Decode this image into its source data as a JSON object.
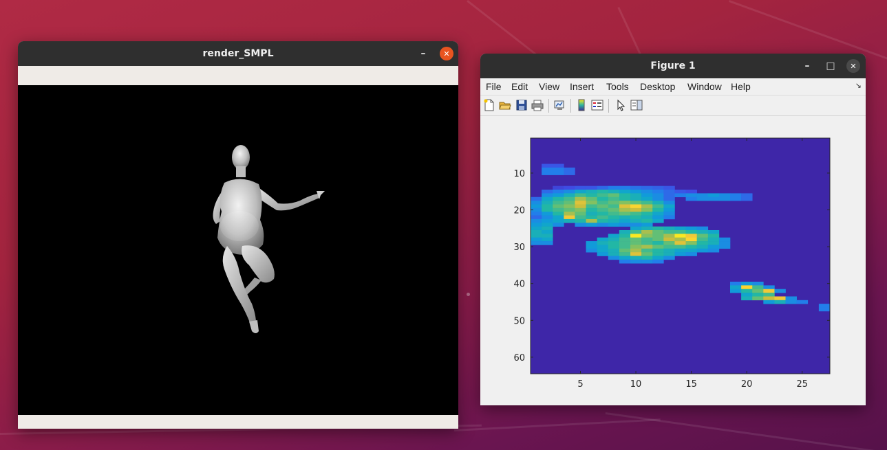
{
  "render_window": {
    "title": "render_SMPL",
    "minimize_symbol": "–",
    "close_symbol": "✕"
  },
  "figure_window": {
    "title": "Figure 1",
    "minimize_symbol": "–",
    "maximize_symbol": "□",
    "close_symbol": "✕",
    "menu": [
      "File",
      "Edit",
      "View",
      "Insert",
      "Tools",
      "Desktop",
      "Window",
      "Help"
    ],
    "dock_symbol": "↘",
    "toolbar_icons": [
      "new-figure-icon",
      "open-file-icon",
      "save-icon",
      "print-icon",
      "link-plot-icon",
      "colorbar-icon",
      "legend-icon",
      "pointer-icon",
      "property-editor-icon"
    ]
  },
  "chart_data": {
    "type": "heatmap",
    "title": "",
    "xlabel": "",
    "ylabel": "",
    "x_ticks": [
      5,
      10,
      15,
      20,
      25
    ],
    "y_ticks": [
      10,
      20,
      30,
      40,
      50,
      60
    ],
    "xlim": [
      0.5,
      27.5
    ],
    "ylim": [
      0.5,
      64.5
    ],
    "y_reversed": true,
    "colormap": "parula",
    "background_value": 0,
    "value_range": [
      0,
      1
    ],
    "cells": [
      [
        2,
        8,
        0.15
      ],
      [
        3,
        8,
        0.15
      ],
      [
        2,
        9,
        0.25
      ],
      [
        3,
        9,
        0.25
      ],
      [
        4,
        9,
        0.2
      ],
      [
        2,
        10,
        0.25
      ],
      [
        3,
        10,
        0.25
      ],
      [
        4,
        10,
        0.2
      ],
      [
        3,
        14,
        0.1
      ],
      [
        4,
        14,
        0.12
      ],
      [
        5,
        14,
        0.15
      ],
      [
        6,
        14,
        0.15
      ],
      [
        7,
        14,
        0.2
      ],
      [
        8,
        14,
        0.25
      ],
      [
        9,
        14,
        0.25
      ],
      [
        10,
        14,
        0.22
      ],
      [
        11,
        14,
        0.2
      ],
      [
        12,
        14,
        0.18
      ],
      [
        13,
        14,
        0.15
      ],
      [
        2,
        15,
        0.2
      ],
      [
        3,
        15,
        0.25
      ],
      [
        4,
        15,
        0.3
      ],
      [
        5,
        15,
        0.4
      ],
      [
        6,
        15,
        0.45
      ],
      [
        7,
        15,
        0.5
      ],
      [
        8,
        15,
        0.45
      ],
      [
        9,
        15,
        0.4
      ],
      [
        10,
        15,
        0.35
      ],
      [
        11,
        15,
        0.3
      ],
      [
        12,
        15,
        0.25
      ],
      [
        13,
        15,
        0.2
      ],
      [
        14,
        15,
        0.15
      ],
      [
        15,
        15,
        0.12
      ],
      [
        2,
        16,
        0.3
      ],
      [
        3,
        16,
        0.35
      ],
      [
        4,
        16,
        0.45
      ],
      [
        5,
        16,
        0.55
      ],
      [
        6,
        16,
        0.5
      ],
      [
        7,
        16,
        0.55
      ],
      [
        8,
        16,
        0.6
      ],
      [
        9,
        16,
        0.5
      ],
      [
        10,
        16,
        0.45
      ],
      [
        11,
        16,
        0.35
      ],
      [
        12,
        16,
        0.3
      ],
      [
        13,
        16,
        0.2
      ],
      [
        14,
        16,
        0.25
      ],
      [
        15,
        16,
        0.3
      ],
      [
        16,
        16,
        0.3
      ],
      [
        17,
        16,
        0.35
      ],
      [
        18,
        16,
        0.3
      ],
      [
        19,
        16,
        0.25
      ],
      [
        20,
        16,
        0.2
      ],
      [
        1,
        17,
        0.2
      ],
      [
        2,
        17,
        0.4
      ],
      [
        3,
        17,
        0.5
      ],
      [
        4,
        17,
        0.55
      ],
      [
        5,
        17,
        0.7
      ],
      [
        6,
        17,
        0.6
      ],
      [
        7,
        17,
        0.5
      ],
      [
        8,
        17,
        0.55
      ],
      [
        9,
        17,
        0.5
      ],
      [
        10,
        17,
        0.45
      ],
      [
        11,
        17,
        0.4
      ],
      [
        12,
        17,
        0.3
      ],
      [
        13,
        17,
        0.2
      ],
      [
        15,
        17,
        0.25
      ],
      [
        16,
        17,
        0.3
      ],
      [
        17,
        17,
        0.3
      ],
      [
        18,
        17,
        0.3
      ],
      [
        19,
        17,
        0.25
      ],
      [
        20,
        17,
        0.2
      ],
      [
        1,
        18,
        0.3
      ],
      [
        2,
        18,
        0.45
      ],
      [
        3,
        18,
        0.55
      ],
      [
        4,
        18,
        0.6
      ],
      [
        5,
        18,
        0.8
      ],
      [
        6,
        18,
        0.65
      ],
      [
        7,
        18,
        0.55
      ],
      [
        8,
        18,
        0.6
      ],
      [
        9,
        18,
        0.65
      ],
      [
        10,
        18,
        0.6
      ],
      [
        11,
        18,
        0.55
      ],
      [
        12,
        18,
        0.45
      ],
      [
        13,
        18,
        0.3
      ],
      [
        1,
        19,
        0.35
      ],
      [
        2,
        19,
        0.5
      ],
      [
        3,
        19,
        0.6
      ],
      [
        4,
        19,
        0.65
      ],
      [
        5,
        19,
        0.75
      ],
      [
        6,
        19,
        0.55
      ],
      [
        7,
        19,
        0.6
      ],
      [
        8,
        19,
        0.55
      ],
      [
        9,
        19,
        0.8
      ],
      [
        10,
        19,
        0.9
      ],
      [
        11,
        19,
        0.7
      ],
      [
        12,
        19,
        0.55
      ],
      [
        13,
        19,
        0.4
      ],
      [
        1,
        20,
        0.3
      ],
      [
        2,
        20,
        0.5
      ],
      [
        3,
        20,
        0.55
      ],
      [
        4,
        20,
        0.6
      ],
      [
        5,
        20,
        0.65
      ],
      [
        6,
        20,
        0.5
      ],
      [
        7,
        20,
        0.55
      ],
      [
        8,
        20,
        0.6
      ],
      [
        9,
        20,
        0.7
      ],
      [
        10,
        20,
        0.75
      ],
      [
        11,
        20,
        0.65
      ],
      [
        12,
        20,
        0.5
      ],
      [
        13,
        20,
        0.35
      ],
      [
        1,
        21,
        0.25
      ],
      [
        2,
        21,
        0.35
      ],
      [
        3,
        21,
        0.5
      ],
      [
        4,
        21,
        0.7
      ],
      [
        5,
        21,
        0.6
      ],
      [
        6,
        21,
        0.45
      ],
      [
        7,
        21,
        0.5
      ],
      [
        8,
        21,
        0.55
      ],
      [
        9,
        21,
        0.6
      ],
      [
        10,
        21,
        0.55
      ],
      [
        11,
        21,
        0.5
      ],
      [
        12,
        21,
        0.4
      ],
      [
        13,
        21,
        0.3
      ],
      [
        1,
        22,
        0.2
      ],
      [
        2,
        22,
        0.3
      ],
      [
        3,
        22,
        0.4
      ],
      [
        4,
        22,
        0.85
      ],
      [
        5,
        22,
        0.55
      ],
      [
        6,
        22,
        0.5
      ],
      [
        7,
        22,
        0.55
      ],
      [
        8,
        22,
        0.5
      ],
      [
        9,
        22,
        0.45
      ],
      [
        10,
        22,
        0.5
      ],
      [
        11,
        22,
        0.45
      ],
      [
        12,
        22,
        0.35
      ],
      [
        13,
        22,
        0.25
      ],
      [
        1,
        23,
        0.3
      ],
      [
        2,
        23,
        0.35
      ],
      [
        3,
        23,
        0.4
      ],
      [
        4,
        23,
        0.45
      ],
      [
        5,
        23,
        0.5
      ],
      [
        6,
        23,
        0.7
      ],
      [
        7,
        23,
        0.5
      ],
      [
        8,
        23,
        0.45
      ],
      [
        9,
        23,
        0.4
      ],
      [
        10,
        23,
        0.45
      ],
      [
        11,
        23,
        0.5
      ],
      [
        12,
        23,
        0.4
      ],
      [
        1,
        24,
        0.35
      ],
      [
        2,
        24,
        0.4
      ],
      [
        3,
        24,
        0.3
      ],
      [
        5,
        24,
        0.3
      ],
      [
        6,
        24,
        0.35
      ],
      [
        7,
        24,
        0.3
      ],
      [
        8,
        24,
        0.35
      ],
      [
        9,
        24,
        0.3
      ],
      [
        10,
        24,
        0.3
      ],
      [
        11,
        24,
        0.35
      ],
      [
        1,
        25,
        0.4
      ],
      [
        2,
        25,
        0.45
      ],
      [
        10,
        25,
        0.4
      ],
      [
        11,
        25,
        0.45
      ],
      [
        12,
        25,
        0.5
      ],
      [
        13,
        25,
        0.45
      ],
      [
        14,
        25,
        0.4
      ],
      [
        15,
        25,
        0.35
      ],
      [
        16,
        25,
        0.3
      ],
      [
        1,
        26,
        0.45
      ],
      [
        2,
        26,
        0.4
      ],
      [
        9,
        26,
        0.45
      ],
      [
        10,
        26,
        0.55
      ],
      [
        11,
        26,
        0.7
      ],
      [
        12,
        26,
        0.6
      ],
      [
        13,
        26,
        0.55
      ],
      [
        14,
        26,
        0.55
      ],
      [
        15,
        26,
        0.5
      ],
      [
        16,
        26,
        0.45
      ],
      [
        17,
        26,
        0.4
      ],
      [
        1,
        27,
        0.45
      ],
      [
        2,
        27,
        0.45
      ],
      [
        8,
        27,
        0.4
      ],
      [
        9,
        27,
        0.5
      ],
      [
        10,
        27,
        0.95
      ],
      [
        11,
        27,
        0.65
      ],
      [
        12,
        27,
        0.6
      ],
      [
        13,
        27,
        0.7
      ],
      [
        14,
        27,
        0.95
      ],
      [
        15,
        27,
        0.85
      ],
      [
        16,
        27,
        0.6
      ],
      [
        17,
        27,
        0.5
      ],
      [
        1,
        28,
        0.35
      ],
      [
        2,
        28,
        0.4
      ],
      [
        7,
        28,
        0.4
      ],
      [
        8,
        28,
        0.45
      ],
      [
        9,
        28,
        0.55
      ],
      [
        10,
        28,
        0.6
      ],
      [
        11,
        28,
        0.55
      ],
      [
        12,
        28,
        0.6
      ],
      [
        13,
        28,
        0.75
      ],
      [
        14,
        28,
        0.7
      ],
      [
        15,
        28,
        0.9
      ],
      [
        16,
        28,
        0.55
      ],
      [
        17,
        28,
        0.45
      ],
      [
        18,
        28,
        0.3
      ],
      [
        1,
        29,
        0.3
      ],
      [
        2,
        29,
        0.3
      ],
      [
        6,
        29,
        0.35
      ],
      [
        7,
        29,
        0.45
      ],
      [
        8,
        29,
        0.5
      ],
      [
        9,
        29,
        0.55
      ],
      [
        10,
        29,
        0.6
      ],
      [
        11,
        29,
        0.55
      ],
      [
        12,
        29,
        0.5
      ],
      [
        13,
        29,
        0.6
      ],
      [
        14,
        29,
        0.8
      ],
      [
        15,
        29,
        0.65
      ],
      [
        16,
        29,
        0.5
      ],
      [
        17,
        29,
        0.45
      ],
      [
        18,
        29,
        0.3
      ],
      [
        6,
        30,
        0.35
      ],
      [
        7,
        30,
        0.4
      ],
      [
        8,
        30,
        0.5
      ],
      [
        9,
        30,
        0.55
      ],
      [
        10,
        30,
        0.65
      ],
      [
        11,
        30,
        0.7
      ],
      [
        12,
        30,
        0.6
      ],
      [
        13,
        30,
        0.55
      ],
      [
        14,
        30,
        0.55
      ],
      [
        15,
        30,
        0.5
      ],
      [
        16,
        30,
        0.45
      ],
      [
        17,
        30,
        0.35
      ],
      [
        18,
        30,
        0.3
      ],
      [
        6,
        31,
        0.3
      ],
      [
        7,
        31,
        0.4
      ],
      [
        8,
        31,
        0.45
      ],
      [
        9,
        31,
        0.6
      ],
      [
        10,
        31,
        0.7
      ],
      [
        11,
        31,
        0.55
      ],
      [
        12,
        31,
        0.5
      ],
      [
        13,
        31,
        0.45
      ],
      [
        14,
        31,
        0.4
      ],
      [
        15,
        31,
        0.4
      ],
      [
        16,
        31,
        0.35
      ],
      [
        17,
        31,
        0.3
      ],
      [
        7,
        32,
        0.35
      ],
      [
        8,
        32,
        0.45
      ],
      [
        9,
        32,
        0.55
      ],
      [
        10,
        32,
        0.8
      ],
      [
        11,
        32,
        0.6
      ],
      [
        12,
        32,
        0.5
      ],
      [
        13,
        32,
        0.45
      ],
      [
        14,
        32,
        0.35
      ],
      [
        15,
        32,
        0.3
      ],
      [
        8,
        33,
        0.3
      ],
      [
        9,
        33,
        0.4
      ],
      [
        10,
        33,
        0.45
      ],
      [
        11,
        33,
        0.5
      ],
      [
        12,
        33,
        0.4
      ],
      [
        13,
        33,
        0.3
      ],
      [
        9,
        34,
        0.25
      ],
      [
        10,
        34,
        0.3
      ],
      [
        11,
        34,
        0.3
      ],
      [
        12,
        34,
        0.25
      ],
      [
        19,
        40,
        0.25
      ],
      [
        20,
        40,
        0.35
      ],
      [
        21,
        40,
        0.3
      ],
      [
        19,
        41,
        0.4
      ],
      [
        20,
        41,
        0.9
      ],
      [
        21,
        41,
        0.55
      ],
      [
        22,
        41,
        0.3
      ],
      [
        19,
        42,
        0.35
      ],
      [
        20,
        42,
        0.5
      ],
      [
        21,
        42,
        0.6
      ],
      [
        22,
        42,
        0.85
      ],
      [
        23,
        42,
        0.3
      ],
      [
        20,
        43,
        0.4
      ],
      [
        21,
        43,
        0.5
      ],
      [
        22,
        43,
        0.55
      ],
      [
        20,
        44,
        0.45
      ],
      [
        21,
        44,
        0.6
      ],
      [
        22,
        44,
        0.75
      ],
      [
        23,
        44,
        0.85
      ],
      [
        24,
        44,
        0.3
      ],
      [
        22,
        45,
        0.35
      ],
      [
        23,
        45,
        0.45
      ],
      [
        24,
        45,
        0.3
      ],
      [
        25,
        45,
        0.25
      ],
      [
        27,
        46,
        0.25
      ],
      [
        27,
        47,
        0.25
      ]
    ]
  }
}
